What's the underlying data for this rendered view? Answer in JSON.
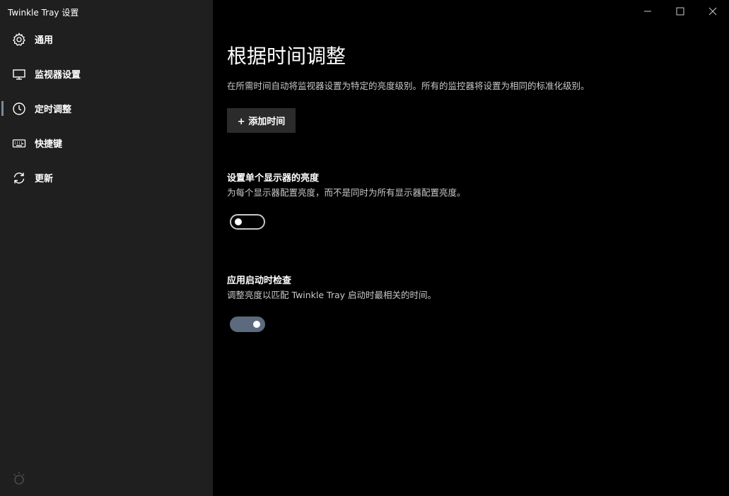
{
  "app": {
    "title": "Twinkle Tray 设置"
  },
  "sidebar": {
    "items": [
      {
        "label": "通用",
        "icon": "gear-icon"
      },
      {
        "label": "监视器设置",
        "icon": "monitor-icon"
      },
      {
        "label": "定时调整",
        "icon": "clock-icon",
        "active": true
      },
      {
        "label": "快捷键",
        "icon": "keyboard-icon"
      },
      {
        "label": "更新",
        "icon": "refresh-icon"
      }
    ]
  },
  "page": {
    "title": "根据时间调整",
    "description": "在所需时间自动将监视器设置为特定的亮度级别。所有的监控器将设置为相同的标准化级别。",
    "add_time_label": "+ 添加时间"
  },
  "settings": {
    "per_monitor": {
      "title": "设置单个显示器的亮度",
      "description": "为每个显示器配置亮度，而不是同时为所有显示器配置亮度。",
      "enabled": false
    },
    "check_on_start": {
      "title": "应用启动时检查",
      "description": "调整亮度以匹配 Twinkle Tray 启动时最相关的时间。",
      "enabled": true
    }
  },
  "colors": {
    "sidebar_bg": "#1f1f1f",
    "main_bg": "#000000",
    "accent": "#5b6b7d",
    "button_bg": "#2b2b2b"
  }
}
